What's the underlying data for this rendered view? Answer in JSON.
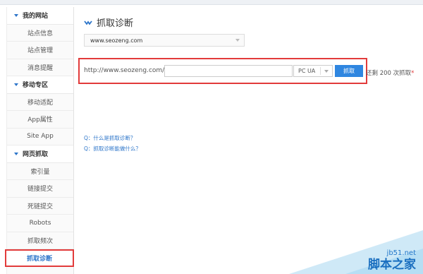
{
  "sidebar": {
    "groups": [
      {
        "label": "我的网站",
        "items": [
          "站点信息",
          "站点管理",
          "消息提醒"
        ]
      },
      {
        "label": "移动专区",
        "items": [
          "移动适配",
          "App属性",
          "Site App"
        ]
      },
      {
        "label": "网页抓取",
        "items": [
          "索引量",
          "链接提交",
          "死链提交",
          "Robots",
          "抓取频次",
          "抓取诊断"
        ]
      }
    ],
    "active_item": "抓取诊断"
  },
  "main": {
    "title": "抓取诊断",
    "title_icon": "chevron-wave-icon",
    "site_select": {
      "value": "www.seozeng.com"
    },
    "fetch": {
      "url_prefix": "http://www.seozeng.com/",
      "url_value": "",
      "ua_select": "PC UA",
      "button_label": "抓取",
      "remaining_text": "还剩 200 次抓取",
      "remaining_marker": "*"
    },
    "faq": [
      "Q：什么是抓取诊断？",
      "Q：抓取诊断能做什么？"
    ]
  },
  "watermark": {
    "site": "jb51.net",
    "cn": "脚本之家"
  },
  "colors": {
    "accent": "#2b74c9",
    "button": "#2f86e0",
    "highlight": "#e23b3b"
  }
}
